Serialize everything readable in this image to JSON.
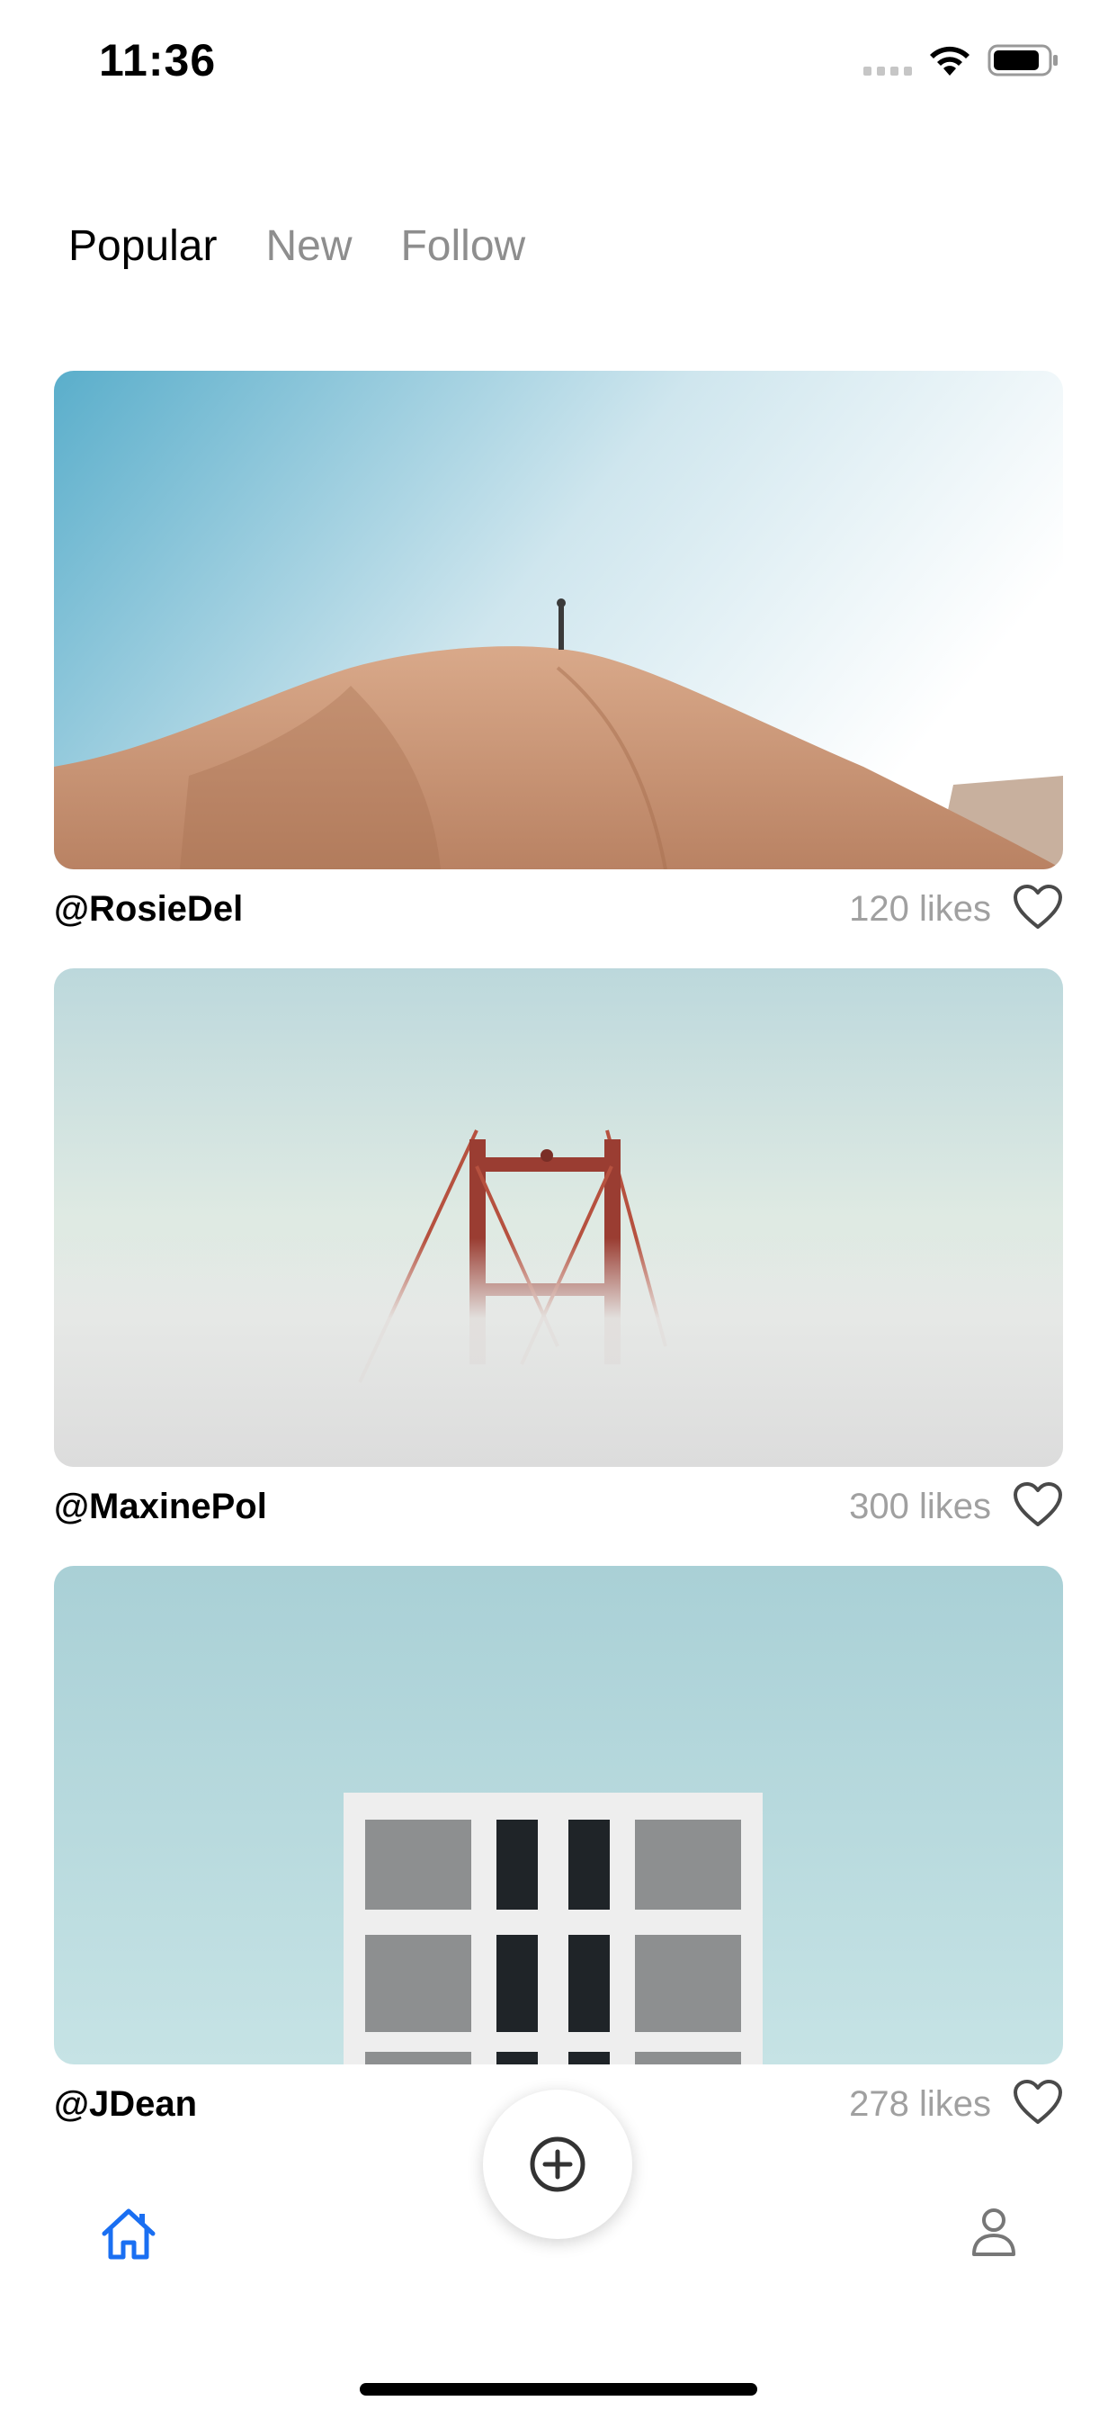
{
  "status_bar": {
    "time": "11:36",
    "icons": [
      "signal-dots-icon",
      "wifi-icon",
      "battery-icon"
    ]
  },
  "tabs": [
    {
      "label": "Popular",
      "active": true
    },
    {
      "label": "New",
      "active": false
    },
    {
      "label": "Follow",
      "active": false
    }
  ],
  "posts": [
    {
      "username": "@RosieDel",
      "likes": "120 likes",
      "image": "desert sand dune with lone figure on top"
    },
    {
      "username": "@MaxinePol",
      "likes": "300 likes",
      "image": "bridge tower emerging from fog"
    },
    {
      "username": "@JDean",
      "likes": "278 likes",
      "image": "white building facade against pale blue sky"
    }
  ],
  "bottom_nav": {
    "items": [
      "home-icon",
      "add-icon",
      "profile-icon"
    ]
  },
  "colors": {
    "accent": "#1a6ff2",
    "tab_inactive": "#8e8e8e",
    "likes_text": "#a0a0a0"
  }
}
